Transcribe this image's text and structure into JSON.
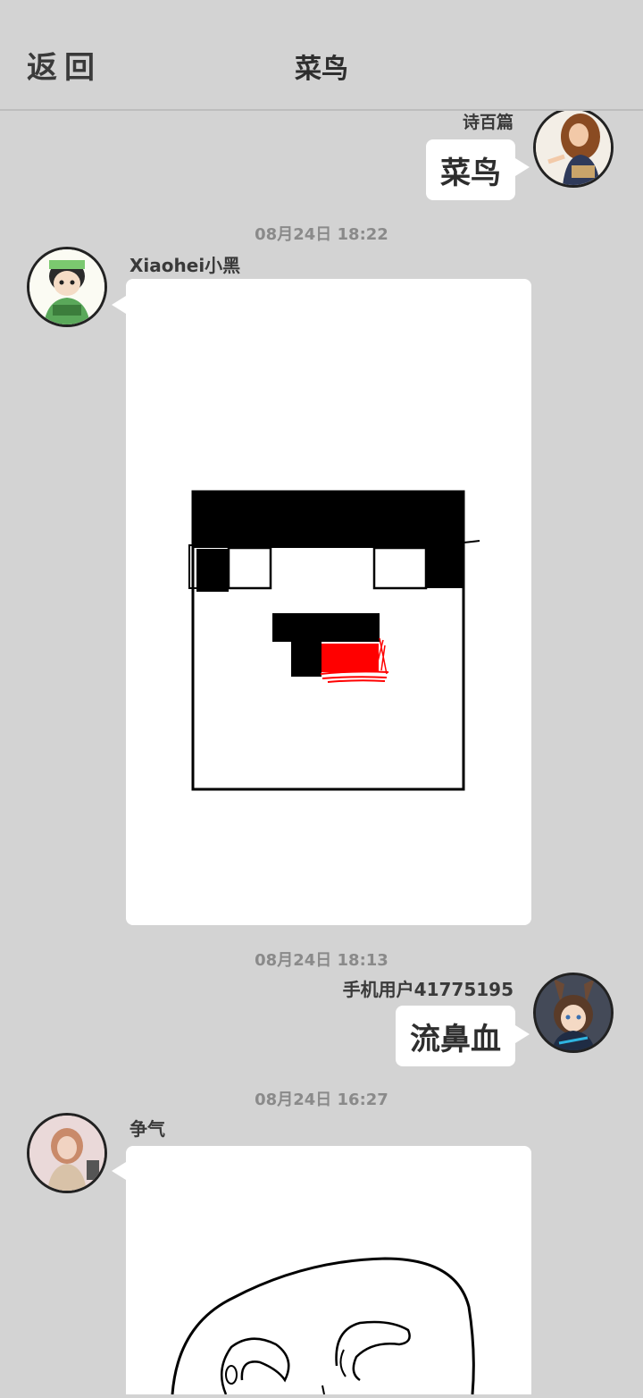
{
  "header": {
    "back_label": "返回",
    "title": "菜鸟"
  },
  "messages": [
    {
      "sender": "诗百篇",
      "text": "菜鸟",
      "side": "right",
      "avatar": "girl-curly-hair-avatar"
    },
    {
      "timestamp": "08月24日  18:22",
      "sender": "Xiaohei小黑",
      "side": "left",
      "avatar": "green-hat-cartoon-avatar",
      "content": "pixel-face-drawing"
    },
    {
      "timestamp": "08月24日  18:13",
      "sender": "手机用户41775195",
      "text": "流鼻血",
      "side": "right",
      "avatar": "bunny-ear-anime-avatar"
    },
    {
      "timestamp": "08月24日  16:27",
      "sender": "争气",
      "side": "left",
      "avatar": "woman-photo-avatar",
      "content": "face-sketch-drawing"
    }
  ],
  "colors": {
    "background": "#d3d3d3",
    "bubble": "#ffffff",
    "nosebleed_red": "#ff0000"
  }
}
